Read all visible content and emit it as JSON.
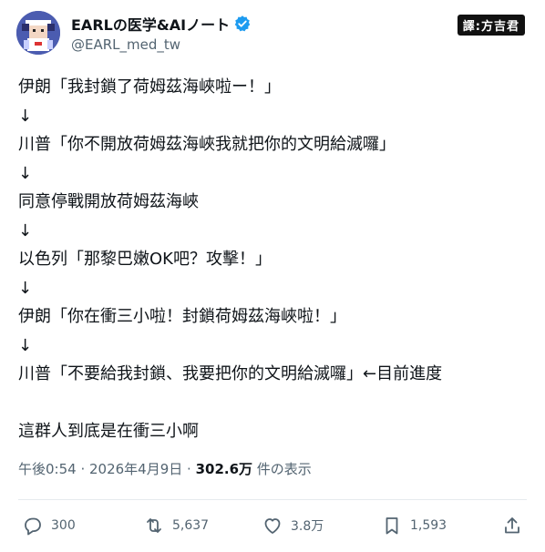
{
  "author": {
    "display_name": "EARLの医学&AIノート",
    "handle": "@EARL_med_tw",
    "verified_icon": "verified-badge-icon",
    "avatar_icon": "pixel-character-avatar"
  },
  "watermark": "譯:方吉君",
  "tweet_lines": [
    "伊朗「我封鎖了荷姆茲海峽啦ー！」",
    "↓",
    "川普「你不開放荷姆茲海峽我就把你的文明給滅囉」",
    "↓",
    "同意停戰開放荷姆茲海峽",
    "↓",
    "以色列「那黎巴嫩OK吧？攻擊！」",
    "↓",
    "伊朗「你在衝三小啦！封鎖荷姆茲海峽啦！」",
    "↓",
    "川普「不要給我封鎖、我要把你的文明給滅囉」←目前進度",
    "",
    "這群人到底是在衝三小啊"
  ],
  "meta": {
    "time": "午後0:54",
    "sep": " · ",
    "date": "2026年4月9日",
    "views_num": "302.6万",
    "views_label": " 件の表示"
  },
  "actions": {
    "replies": "300",
    "reposts": "5,637",
    "likes": "3.8万",
    "bookmarks": "1,593"
  },
  "colors": {
    "text": "#0f1419",
    "secondary": "#536471",
    "verified": "#1d9bf0",
    "divider": "#e6ebee"
  }
}
